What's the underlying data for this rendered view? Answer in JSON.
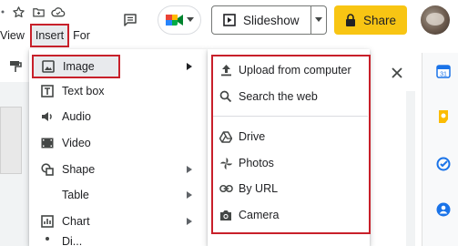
{
  "topbar": {
    "title_icons": [
      "dot-icon",
      "star-icon",
      "move-to-folder-icon",
      "cloud-icon"
    ],
    "menu": {
      "view": "View",
      "insert": "Insert",
      "format": "For"
    },
    "slideshow_label": "Slideshow",
    "share_label": "Share"
  },
  "insert_menu": {
    "items": [
      {
        "label": "Image",
        "icon": "image-icon",
        "has_submenu": true
      },
      {
        "label": "Text box",
        "icon": "text-box-icon",
        "has_submenu": false
      },
      {
        "label": "Audio",
        "icon": "audio-icon",
        "has_submenu": false
      },
      {
        "label": "Video",
        "icon": "video-icon",
        "has_submenu": false
      },
      {
        "label": "Shape",
        "icon": "shape-icon",
        "has_submenu": true
      },
      {
        "label": "Table",
        "icon": "",
        "has_submenu": true
      },
      {
        "label": "Chart",
        "icon": "chart-icon",
        "has_submenu": true
      },
      {
        "label": "Di...",
        "icon": "diagram-icon",
        "has_submenu": false
      }
    ]
  },
  "image_submenu": {
    "items": [
      {
        "label": "Upload from computer",
        "icon": "upload-icon"
      },
      {
        "label": "Search the web",
        "icon": "search-icon"
      },
      {
        "label": "Drive",
        "icon": "drive-icon"
      },
      {
        "label": "Photos",
        "icon": "photos-icon"
      },
      {
        "label": "By URL",
        "icon": "link-icon"
      },
      {
        "label": "Camera",
        "icon": "camera-icon"
      }
    ]
  },
  "colors": {
    "highlight_border": "#c8202a",
    "share_button": "#f8c513",
    "calendar_blue": "#1a73e8",
    "keep_yellow": "#fbbc04",
    "tasks_blue": "#1a73e8",
    "contacts_blue": "#1a73e8"
  }
}
